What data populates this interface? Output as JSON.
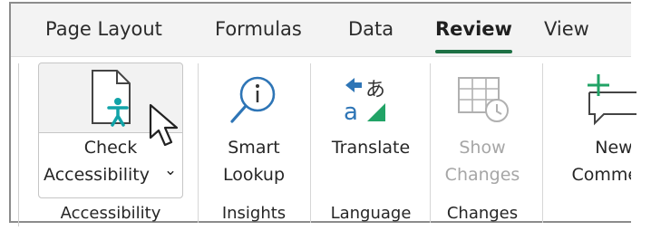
{
  "tabs": [
    {
      "label": "Page Layout",
      "active": false
    },
    {
      "label": "Formulas",
      "active": false
    },
    {
      "label": "Data",
      "active": false
    },
    {
      "label": "Review",
      "active": true
    },
    {
      "label": "View",
      "active": false
    }
  ],
  "buttons": {
    "check_accessibility": {
      "line1": "Check",
      "line2": "Accessibility",
      "dropdown": "⌄"
    },
    "smart_lookup": {
      "line1": "Smart",
      "line2": "Lookup"
    },
    "translate": {
      "line1": "Translate"
    },
    "show_changes": {
      "line1": "Show",
      "line2": "Changes",
      "enabled": false
    },
    "new_comment": {
      "line1": "New",
      "line2": "Comment"
    }
  },
  "groups": {
    "accessibility": "Accessibility",
    "insights": "Insights",
    "language": "Language",
    "changes": "Changes"
  },
  "icons": {
    "check_accessibility": "document-accessibility-icon",
    "smart_lookup": "lookup-magnifier-icon",
    "translate": "translate-icon",
    "show_changes": "show-changes-icon",
    "new_comment": "new-comment-icon",
    "cursor": "mouse-pointer-icon"
  },
  "colors": {
    "accent": "#1e7145",
    "icon_blue": "#2e75b6",
    "icon_teal": "#11a3a8",
    "icon_green": "#21a366",
    "disabled": "#a6a6a6"
  }
}
